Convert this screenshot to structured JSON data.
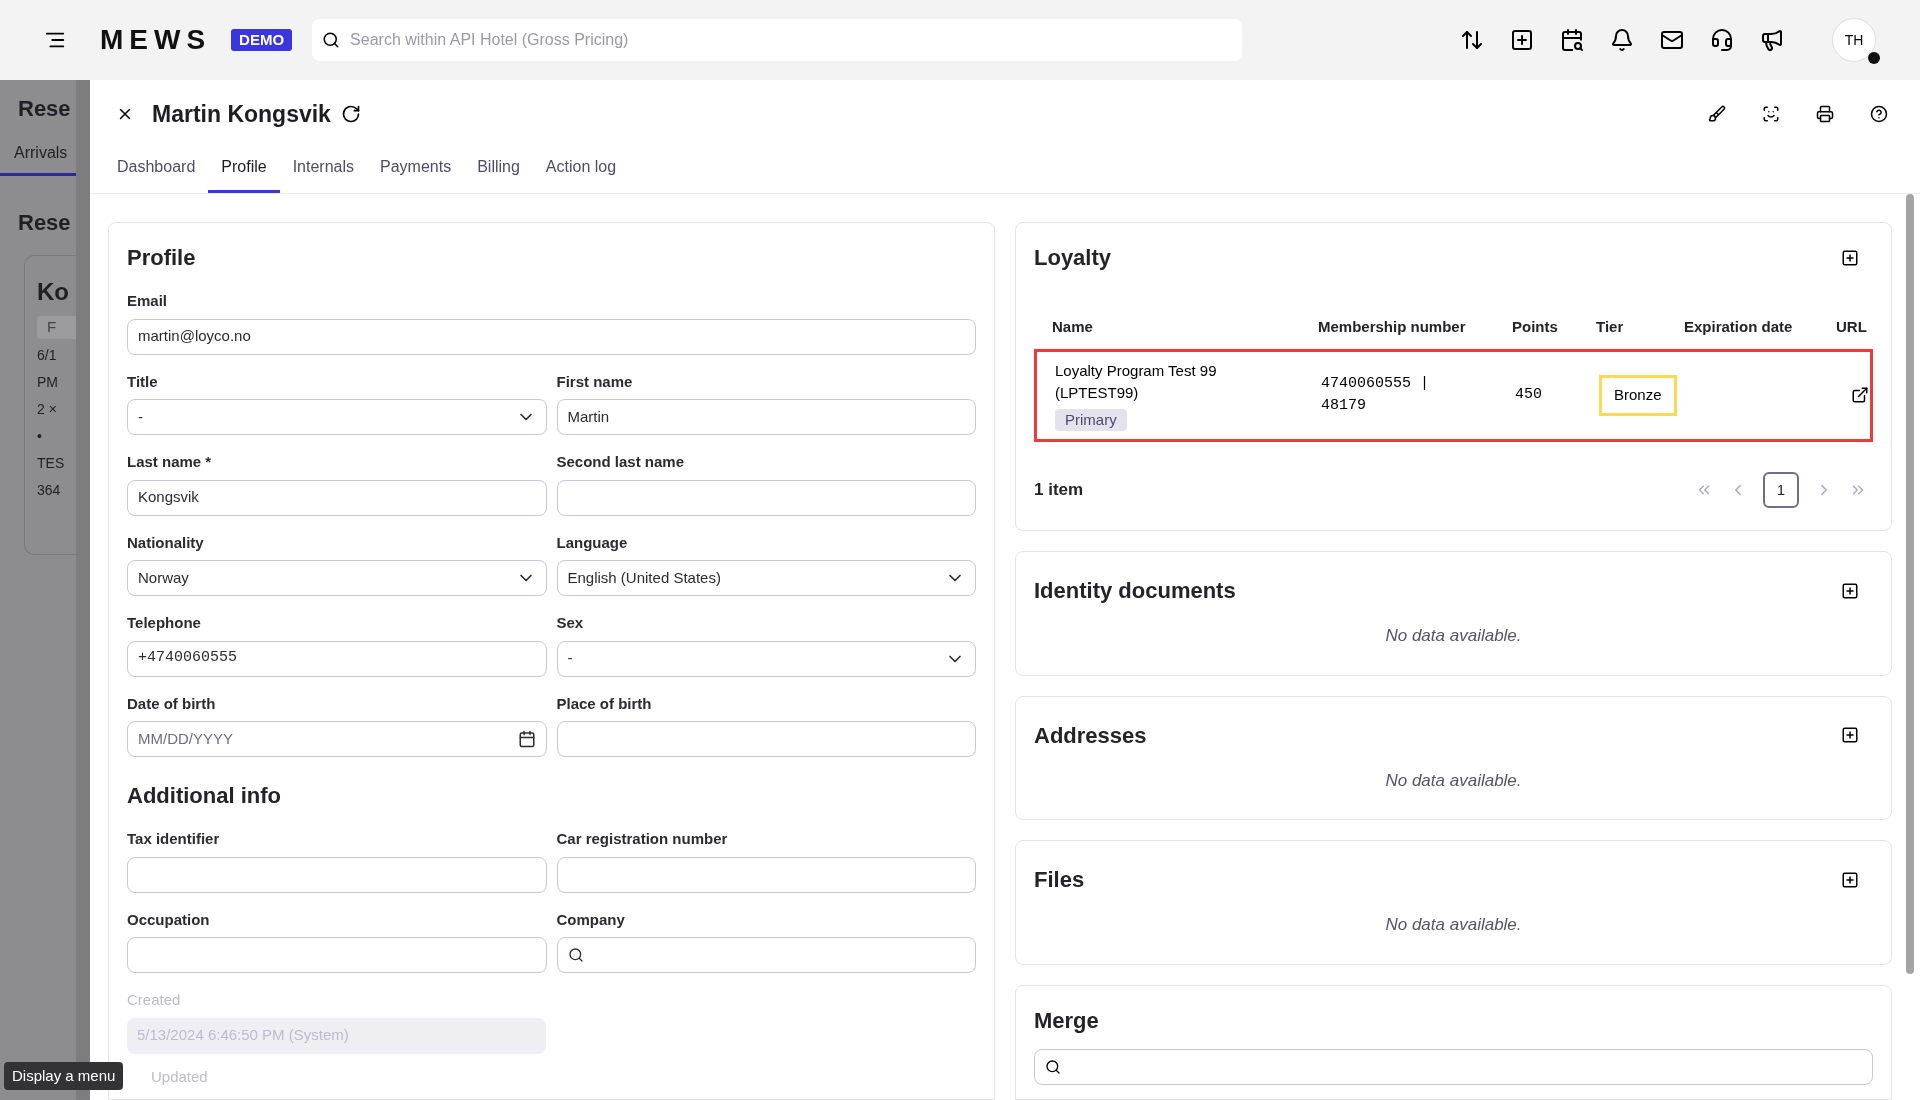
{
  "topbar": {
    "logo": "MEWS",
    "badge": "DEMO",
    "search": {
      "placeholder": "Search within API Hotel (Gross Pricing)"
    },
    "avatar": "TH"
  },
  "background_page": {
    "title": "Rese",
    "tab": "Arrivals",
    "heading": "Rese",
    "card": {
      "title": "Ko",
      "chip": "F",
      "lines": [
        "6/1",
        "PM",
        "2 ×",
        "•",
        "TES",
        "364"
      ]
    }
  },
  "drawer": {
    "title": "Martin Kongsvik",
    "tabs": [
      {
        "label": "Dashboard",
        "selected": false
      },
      {
        "label": "Profile",
        "selected": true
      },
      {
        "label": "Internals",
        "selected": false
      },
      {
        "label": "Payments",
        "selected": false
      },
      {
        "label": "Billing",
        "selected": false
      },
      {
        "label": "Action log",
        "selected": false
      }
    ],
    "profile": {
      "title": "Profile",
      "email": {
        "label": "Email",
        "value": "martin@loyco.no"
      },
      "fields": [
        {
          "kind": "select",
          "label": "Title",
          "value": "-"
        },
        {
          "kind": "text",
          "label": "First name",
          "value": "Martin"
        },
        {
          "kind": "text",
          "label": "Last name *",
          "value": "Kongsvik"
        },
        {
          "kind": "text",
          "label": "Second last name"
        },
        {
          "kind": "select",
          "label": "Nationality",
          "value": "Norway"
        },
        {
          "kind": "select",
          "label": "Language",
          "value": "English (United States)"
        },
        {
          "kind": "phone",
          "label": "Telephone",
          "value": "+4740060555"
        },
        {
          "kind": "select",
          "label": "Sex",
          "value": "-"
        },
        {
          "kind": "date",
          "label": "Date of birth",
          "placeholder": "MM/DD/YYYY"
        },
        {
          "kind": "text",
          "label": "Place of birth"
        }
      ],
      "additional_title": "Additional info",
      "additional_fields": [
        {
          "kind": "text",
          "label": "Tax identifier"
        },
        {
          "kind": "text",
          "label": "Car registration number"
        },
        {
          "kind": "text",
          "label": "Occupation"
        },
        {
          "kind": "search",
          "label": "Company"
        }
      ],
      "created": {
        "label": "Created",
        "value": "5/13/2024 6:46:50 PM (System)",
        "disabled": true
      },
      "updated_label": "Updated"
    },
    "loyalty": {
      "title": "Loyalty",
      "columns": [
        "Name",
        "Membership number",
        "Points",
        "Tier",
        "Expiration date",
        "URL"
      ],
      "rows": [
        {
          "name": "Loyalty Program Test 99 (LPTEST99)",
          "badge": "Primary",
          "membership_number": "4740060555 | 48179",
          "points": "450",
          "tier": "Bronze",
          "highlighted": true,
          "tier_highlighted": true
        }
      ],
      "count": "1 item",
      "pages": [
        {
          "label": "1",
          "selected": true
        }
      ]
    },
    "sections": [
      {
        "title": "Identity documents",
        "empty": "No data available."
      },
      {
        "title": "Addresses",
        "empty": "No data available."
      },
      {
        "title": "Files",
        "empty": "No data available."
      }
    ],
    "merge": {
      "title": "Merge"
    }
  },
  "tooltip": "Display a menu"
}
